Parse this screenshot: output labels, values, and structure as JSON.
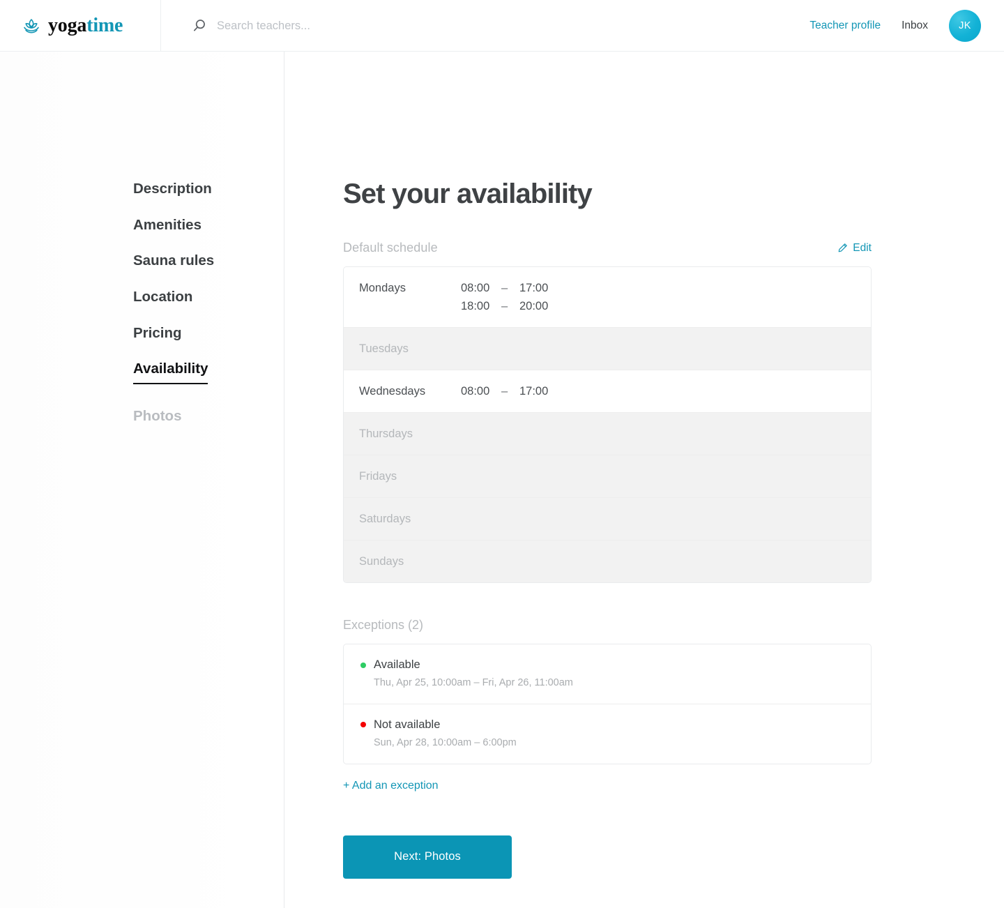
{
  "header": {
    "logo": {
      "icon": "lotus-icon",
      "word_dark": "yoga",
      "word_accent": "time"
    },
    "search": {
      "icon": "search-icon",
      "placeholder": "Search teachers...",
      "value": ""
    },
    "teacher_profile_label": "Teacher profile",
    "inbox_label": "Inbox",
    "avatar_initials": "JK"
  },
  "sidebar": {
    "items": [
      {
        "label": "Description",
        "state": "default"
      },
      {
        "label": "Amenities",
        "state": "default"
      },
      {
        "label": "Sauna rules",
        "state": "default"
      },
      {
        "label": "Location",
        "state": "default"
      },
      {
        "label": "Pricing",
        "state": "default"
      },
      {
        "label": "Availability",
        "state": "active"
      },
      {
        "label": "Photos",
        "state": "muted"
      }
    ]
  },
  "main": {
    "title": "Set your availability",
    "default_schedule": {
      "label": "Default schedule",
      "edit_label": "Edit",
      "edit_icon": "pencil-icon",
      "rows": [
        {
          "day": "Mondays",
          "empty": false,
          "ranges": [
            {
              "from": "08:00",
              "dash": "–",
              "to": "17:00"
            },
            {
              "from": "18:00",
              "dash": "–",
              "to": "20:00"
            }
          ]
        },
        {
          "day": "Tuesdays",
          "empty": true,
          "ranges": []
        },
        {
          "day": "Wednesdays",
          "empty": false,
          "ranges": [
            {
              "from": "08:00",
              "dash": "–",
              "to": "17:00"
            }
          ]
        },
        {
          "day": "Thursdays",
          "empty": true,
          "ranges": []
        },
        {
          "day": "Fridays",
          "empty": true,
          "ranges": []
        },
        {
          "day": "Saturdays",
          "empty": true,
          "ranges": []
        },
        {
          "day": "Sundays",
          "empty": true,
          "ranges": []
        }
      ]
    },
    "exceptions": {
      "label": "Exceptions (2)",
      "count": 2,
      "items": [
        {
          "status": "Available",
          "dot_color": "#2ecc63",
          "when": "Thu, Apr 25, 10:00am – Fri, Apr 26, 11:00am"
        },
        {
          "status": "Not available",
          "dot_color": "#f40000",
          "when": "Sun, Apr 28, 10:00am – 6:00pm"
        }
      ],
      "add_label": "+ Add an exception"
    },
    "next_button_label": "Next: Photos"
  },
  "colors": {
    "accent": "#1396b5",
    "button": "#0b95b5",
    "avatar": "#13b2d6",
    "available": "#2ecc63",
    "not_available": "#f40000"
  }
}
